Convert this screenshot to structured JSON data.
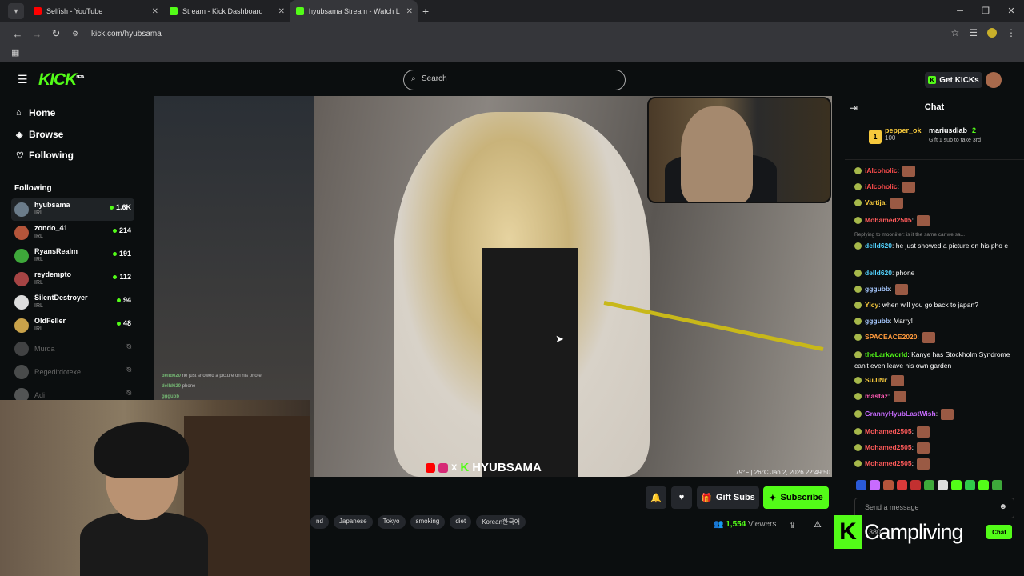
{
  "browser": {
    "tabs": [
      {
        "title": "Selfish - YouTube",
        "color": "#ff0000"
      },
      {
        "title": "Stream - Kick Dashboard",
        "color": "#53fc18"
      },
      {
        "title": "hyubsama Stream - Watch L",
        "color": "#53fc18"
      }
    ],
    "url": "kick.com/hyubsama"
  },
  "header": {
    "logo": "KICK",
    "logo_sup": "BETA",
    "search_placeholder": "Search",
    "get_kicks": "Get KICKs",
    "get_kicks_icon": "K"
  },
  "sidebar": {
    "nav": [
      {
        "label": "Home",
        "icon": "home-icon"
      },
      {
        "label": "Browse",
        "icon": "browse-icon"
      },
      {
        "label": "Following",
        "icon": "heart-icon"
      }
    ],
    "following_header": "Following",
    "channels": [
      {
        "name": "hyubsama",
        "category": "IRL",
        "viewers": "1.6K",
        "live": true,
        "color": "#6b7c8a"
      },
      {
        "name": "zondo_41",
        "category": "IRL",
        "viewers": "214",
        "live": true,
        "color": "#b4553a"
      },
      {
        "name": "RyansRealm",
        "category": "IRL",
        "viewers": "191",
        "live": true,
        "color": "#3ea83a"
      },
      {
        "name": "reydempto",
        "category": "IRL",
        "viewers": "112",
        "live": true,
        "color": "#a64444"
      },
      {
        "name": "SilentDestroyer",
        "category": "IRL",
        "viewers": "94",
        "live": true,
        "color": "#dddddd"
      },
      {
        "name": "OldFeller",
        "category": "IRL",
        "viewers": "48",
        "live": true,
        "color": "#c9a24a"
      },
      {
        "name": "Murda",
        "live": false,
        "color": "#777777"
      },
      {
        "name": "Regeditdotexe",
        "live": false,
        "color": "#888888"
      },
      {
        "name": "Adi",
        "live": false,
        "color": "#999999"
      }
    ]
  },
  "video": {
    "overlay_chat": [
      {
        "user": "delld620",
        "text": "he just showed a picture on his pho e"
      },
      {
        "user": "delld620",
        "text": "phone"
      },
      {
        "user": "gggubb",
        "text": ""
      }
    ],
    "brand": "HYUBSAMA",
    "brand_x": "X",
    "brand_k": "K",
    "stats": "79°F | 26°C   Jan 2, 2026   22:49:50"
  },
  "info": {
    "gift_subs": "Gift Subs",
    "subscribe": "Subscribe",
    "tags": [
      "nd",
      "Japanese",
      "Tokyo",
      "smoking",
      "diet",
      "Korean한국어"
    ],
    "viewer_count": "1,554",
    "viewer_label": "Viewers"
  },
  "chat": {
    "title": "Chat",
    "top1": {
      "name": "pepper_ok",
      "count": "100",
      "rank": "1"
    },
    "top2": {
      "name": "mariusdiab",
      "count": "2"
    },
    "gift_prompt": "Gift 1 sub to take 3rd",
    "messages": [
      {
        "user": "iAlcoholic",
        "color": "#ff4d4d",
        "text": "",
        "emote": true
      },
      {
        "user": "iAlcoholic",
        "color": "#ff4d4d",
        "text": "",
        "emote": true
      },
      {
        "user": "Vartija",
        "color": "#f7c93c",
        "text": "",
        "emote": true
      },
      {
        "user": "Mohamed2505",
        "color": "#ff5a5a",
        "text": "",
        "emote": true
      },
      {
        "user": "delld620",
        "color": "#53d3ff",
        "text": "he just showed a picture on his pho e",
        "emote": false
      },
      {
        "user": "delld620",
        "color": "#53d3ff",
        "text": "phone",
        "emote": false
      },
      {
        "user": "gggubb",
        "color": "#a6c8ff",
        "text": "",
        "emote": true
      },
      {
        "user": "Yicy",
        "color": "#f7c93c",
        "text": "when will you go back to japan?",
        "emote": false
      },
      {
        "user": "gggubb",
        "color": "#a6c8ff",
        "text": "Marry!",
        "emote": false
      },
      {
        "user": "SPACEACE2020",
        "color": "#ff9a3c",
        "text": "",
        "emote": true
      },
      {
        "user": "theLarkworld",
        "color": "#53fc18",
        "text": "Kanye has Stockholm Syndrome can't even leave his own garden",
        "emote": false
      },
      {
        "user": "SuJiNi",
        "color": "#f7c93c",
        "text": "",
        "emote": true
      },
      {
        "user": "mastaz",
        "color": "#ff5ab4",
        "text": "",
        "emote": true
      },
      {
        "user": "GrannyHyubLastWish",
        "color": "#c86bff",
        "text": "",
        "emote": true
      },
      {
        "user": "Mohamed2505",
        "color": "#ff5a5a",
        "text": "",
        "emote": true
      },
      {
        "user": "Mohamed2505",
        "color": "#ff5a5a",
        "text": "",
        "emote": true
      },
      {
        "user": "Mohamed2505",
        "color": "#ff5a5a",
        "text": "",
        "emote": true
      }
    ],
    "reply_note": "Replying to mooniiter: is it the same car we sa...",
    "input_placeholder": "Send a message",
    "send_label": "Chat",
    "counter": "380"
  },
  "watermark": {
    "text": "Campliving",
    "mark": "K"
  },
  "colors": {
    "accent": "#53fc18",
    "bg": "#0b0e0f",
    "panel": "#24272c"
  }
}
